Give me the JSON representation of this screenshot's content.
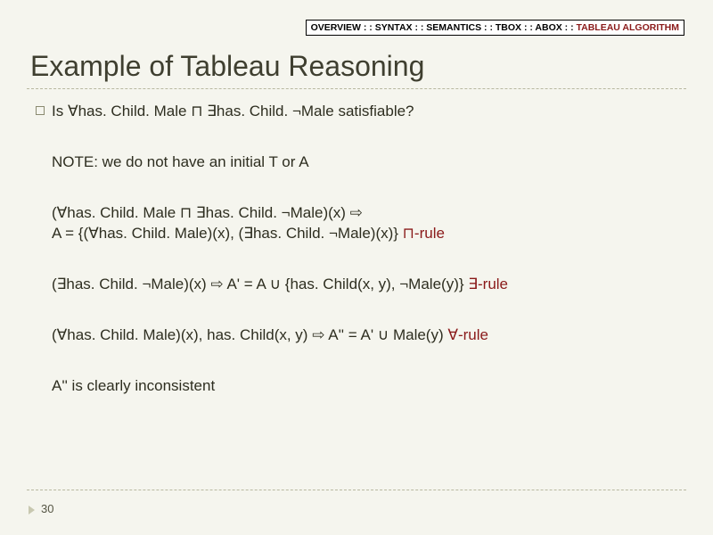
{
  "nav": {
    "overview": "OVERVIEW",
    "syntax": "SYNTAX",
    "semantics": "SEMANTICS",
    "tbox": "TBOX",
    "abox": "ABOX",
    "tableau": "TABLEAU ALGORITHM",
    "sep": " : : "
  },
  "title": "Example of Tableau Reasoning",
  "lines": {
    "question": "Is ∀has. Child. Male ⊓ ∃has. Child. ¬Male satisfiable?",
    "note": "NOTE: we do not have an initial T or A",
    "step1a": "(∀has. Child. Male ⊓ ∃has. Child. ¬Male)(x) ⇨",
    "step1b_main": "A = {(∀has. Child. Male)(x), (∃has. Child. ¬Male)(x)}  ",
    "step1b_rule": "⊓-rule",
    "step2_main": "(∃has. Child. ¬Male)(x) ⇨ A' = A ∪ {has. Child(x, y), ¬Male(y)}  ",
    "step2_rule": "∃-rule",
    "step3_main": "(∀has. Child. Male)(x), has. Child(x, y) ⇨ A'' = A' ∪ Male(y) ",
    "step3_rule": "∀-rule",
    "conclusion": "A'' is clearly inconsistent"
  },
  "page": "30"
}
